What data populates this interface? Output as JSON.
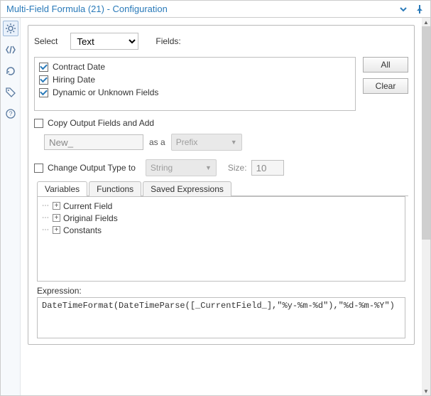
{
  "title": "Multi-Field Formula (21) - Configuration",
  "select": {
    "label": "Select",
    "value": "Text",
    "fields_label": "Fields:"
  },
  "fields": [
    {
      "label": "Contract Date",
      "checked": true
    },
    {
      "label": "Hiring Date",
      "checked": true
    },
    {
      "label": "Dynamic or Unknown Fields",
      "checked": true
    }
  ],
  "buttons": {
    "all": "All",
    "clear": "Clear"
  },
  "copyOutput": {
    "label": "Copy Output Fields and Add",
    "prefix_value": "New_",
    "as_label": "as a",
    "prefix_suffix": "Prefix"
  },
  "changeType": {
    "label": "Change Output Type to",
    "type_value": "String",
    "size_label": "Size:",
    "size_value": "10"
  },
  "tabs": {
    "variables": "Variables",
    "functions": "Functions",
    "saved": "Saved Expressions"
  },
  "tree": [
    "Current Field",
    "Original Fields",
    "Constants"
  ],
  "expression": {
    "label": "Expression:",
    "value": "DateTimeFormat(DateTimeParse([_CurrentField_],\"%y-%m-%d\"),\"%d-%m-%Y\")"
  }
}
